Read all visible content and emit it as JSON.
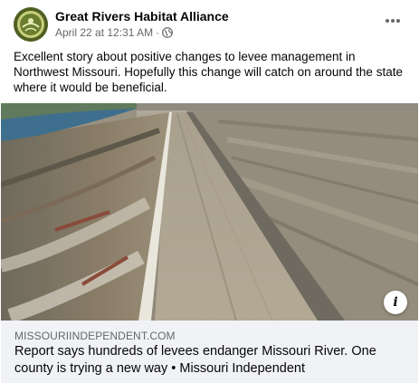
{
  "post": {
    "page_name": "Great Rivers Habitat Alliance",
    "date": "April 22 at 12:31 AM",
    "separator": "·",
    "caption": "Excellent story about positive changes to levee management in Northwest Missouri. Hopefully this change will catch on around the state where it would be beneficial."
  },
  "link": {
    "domain": "MISSOURIINDEPENDENT.COM",
    "title": "Report says hundreds of levees endanger Missouri River. One county is trying a new way • Missouri Independent"
  },
  "icons": {
    "more": "more-horizontal-icon",
    "privacy": "globe-icon",
    "info": "info-icon"
  },
  "colors": {
    "secondary_text": "#65676b",
    "card_bg": "#f0f2f5",
    "river": "#3e6f8e"
  }
}
